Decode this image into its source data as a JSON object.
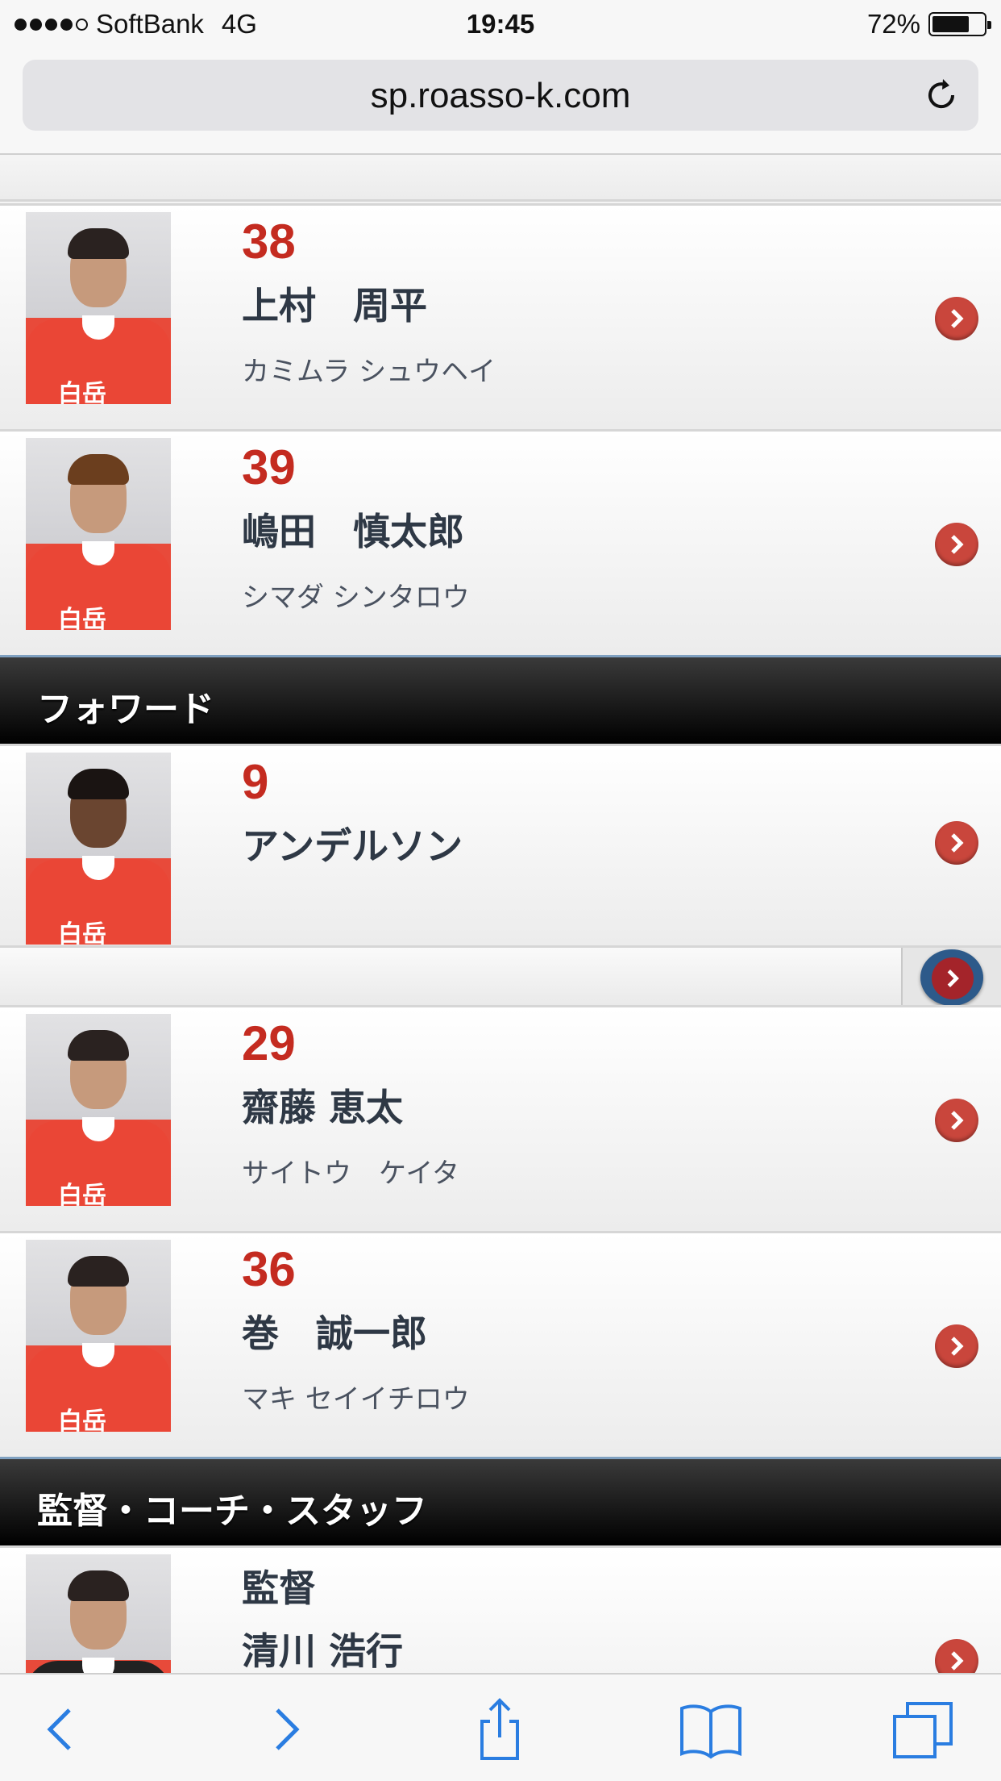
{
  "status_bar": {
    "carrier": "SoftBank",
    "network": "4G",
    "time": "19:45",
    "battery": "72%",
    "battery_level": 0.72
  },
  "browser": {
    "url": "sp.roasso-k.com"
  },
  "players_mf": [
    {
      "number": "38",
      "name": "上村　周平",
      "kana": "カミムラ シュウヘイ"
    },
    {
      "number": "39",
      "name": "嶋田　慎太郎",
      "kana": "シマダ シンタロウ"
    }
  ],
  "sections": {
    "forward": "フォワード",
    "staff": "監督・コーチ・スタッフ"
  },
  "players_fw": [
    {
      "number": "9",
      "name": "アンデルソン",
      "kana": ""
    },
    {
      "number": "29",
      "name": "齋藤 恵太",
      "kana": "サイトウ　ケイタ"
    },
    {
      "number": "36",
      "name": "巻　誠一郎",
      "kana": "マキ セイイチロウ"
    }
  ],
  "staff": [
    {
      "role": "監督",
      "name": "清川 浩行"
    }
  ],
  "jersey_brand": "白岳",
  "colors": {
    "accent_red": "#c42b20",
    "arrow_red": "#c9463c",
    "section_bg": "#000000",
    "ios_blue": "#2a7de1"
  }
}
